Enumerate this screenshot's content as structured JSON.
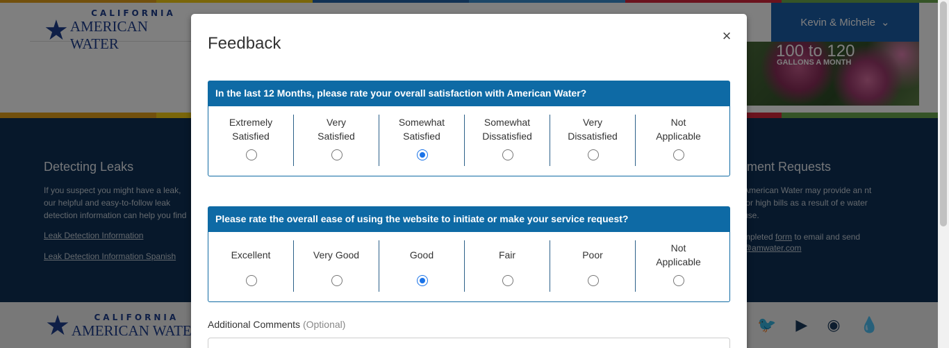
{
  "background": {
    "stripe_colors": [
      "#e4a11b",
      "#f4cc14",
      "#2262a8",
      "#3b8ed0",
      "#d7263d",
      "#6aa84f"
    ],
    "logo": {
      "line1": "CALIFORNIA",
      "line2": "AMERICAN WATER"
    },
    "user_menu": {
      "label": "Kevin & Michele",
      "icon": "chevron-down-icon"
    },
    "banner": {
      "big": "100 to 120",
      "small": "GALLONS A MONTH"
    },
    "leaks": {
      "title": "Detecting Leaks",
      "text": "If you suspect you might have a leak, our helpful and easy-to-follow leak detection information can help you find it.",
      "link1": "Leak Detection Information",
      "link2": "Leak Detection Information Spanish"
    },
    "adjust": {
      "title": "tment Requests",
      "text": "American Water may provide an nt for high bills as a result of e water use.",
      "text2_pre": "mpleted ",
      "text2_link": "form",
      "text2_post": " to email and send",
      "email": "@amwater.com"
    },
    "social_icons": [
      "twitter-icon",
      "youtube-icon",
      "rss-icon",
      "waterdrop-icon"
    ]
  },
  "modal": {
    "title": "Feedback",
    "close_label": "×",
    "question1": {
      "text": "In the last 12 Months, please rate your overall satisfaction with American Water?",
      "options": [
        "Extremely\nSatisfied",
        "Very\nSatisfied",
        "Somewhat\nSatisfied",
        "Somewhat\nDissatisfied",
        "Very\nDissatisfied",
        "Not\nApplicable"
      ],
      "selected": 2
    },
    "question2": {
      "text": "Please rate the overall ease of using the website to initiate or make your service request?",
      "options": [
        "Excellent",
        "Very Good",
        "Good",
        "Fair",
        "Poor",
        "Not\nApplicable"
      ],
      "selected": 2
    },
    "comments": {
      "label": "Additional Comments",
      "optional": "(Optional)",
      "value": ""
    }
  }
}
